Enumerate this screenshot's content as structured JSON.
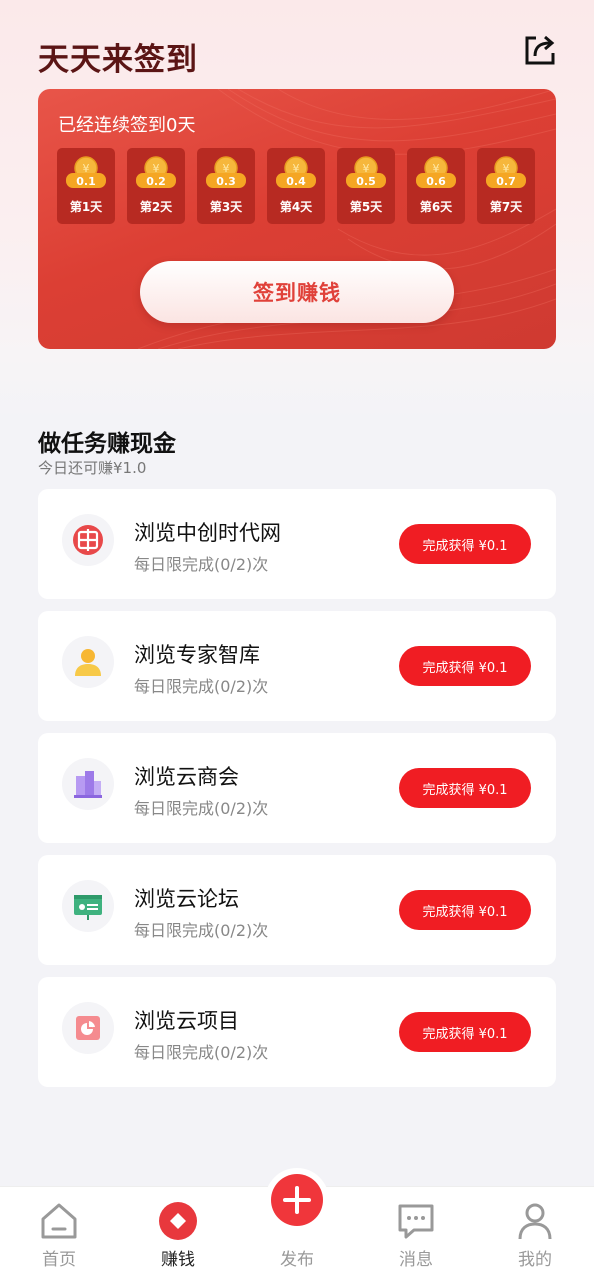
{
  "header": {
    "title": "天天来签到",
    "share_icon": "share-icon"
  },
  "signin": {
    "streak_text": "已经连续签到0天",
    "days": [
      {
        "reward": "0.1",
        "label": "第1天"
      },
      {
        "reward": "0.2",
        "label": "第2天"
      },
      {
        "reward": "0.3",
        "label": "第3天"
      },
      {
        "reward": "0.4",
        "label": "第4天"
      },
      {
        "reward": "0.5",
        "label": "第5天"
      },
      {
        "reward": "0.6",
        "label": "第6天"
      },
      {
        "reward": "0.7",
        "label": "第7天"
      }
    ],
    "button_label": "签到赚钱"
  },
  "tasks": {
    "title": "做任务赚现金",
    "subtitle": "今日还可赚¥1.0",
    "items": [
      {
        "icon": "web-icon",
        "name": "浏览中创时代网",
        "limit": "每日限完成(0/2)次",
        "button": "完成获得 ¥0.1"
      },
      {
        "icon": "user-icon",
        "name": "浏览专家智库",
        "limit": "每日限完成(0/2)次",
        "button": "完成获得 ¥0.1"
      },
      {
        "icon": "building-icon",
        "name": "浏览云商会",
        "limit": "每日限完成(0/2)次",
        "button": "完成获得 ¥0.1"
      },
      {
        "icon": "forum-icon",
        "name": "浏览云论坛",
        "limit": "每日限完成(0/2)次",
        "button": "完成获得 ¥0.1"
      },
      {
        "icon": "project-icon",
        "name": "浏览云项目",
        "limit": "每日限完成(0/2)次",
        "button": "完成获得 ¥0.1"
      }
    ]
  },
  "nav": {
    "items": [
      {
        "label": "首页",
        "icon": "home-icon",
        "active": false
      },
      {
        "label": "赚钱",
        "icon": "earn-icon",
        "active": true
      },
      {
        "label": "发布",
        "icon": "plus-icon",
        "active": false
      },
      {
        "label": "消息",
        "icon": "message-icon",
        "active": false
      },
      {
        "label": "我的",
        "icon": "profile-icon",
        "active": false
      }
    ]
  },
  "colors": {
    "accent": "#f01d23",
    "card_red": "#dc3f34",
    "title_dark_red": "#5b1515"
  }
}
